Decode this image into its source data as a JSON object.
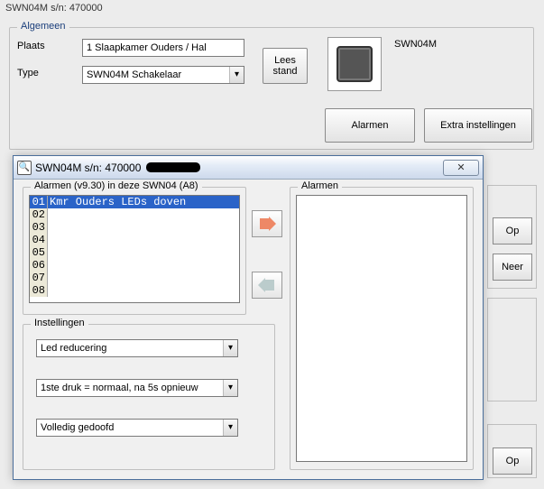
{
  "main": {
    "title": "SWN04M s/n: 470000",
    "group_algemeen": {
      "legend": "Algemeen",
      "plaats_label": "Plaats",
      "plaats_value": "1 Slaapkamer Ouders / Hal",
      "type_label": "Type",
      "type_value": "SWN04M Schakelaar",
      "lees_stand_label": "Lees\nstand",
      "device_name": "SWN04M"
    },
    "buttons": {
      "alarmen": "Alarmen",
      "extra": "Extra instellingen",
      "op": "Op",
      "neer": "Neer"
    }
  },
  "dialog": {
    "title": "SWN04M s/n: 470000",
    "list_group_legend": "Alarmen (v9.30) in deze SWN04 (A8)",
    "alarm_rows": [
      {
        "n": "01",
        "t": "Kmr Ouders LEDs doven",
        "sel": true
      },
      {
        "n": "02",
        "t": ""
      },
      {
        "n": "03",
        "t": ""
      },
      {
        "n": "04",
        "t": ""
      },
      {
        "n": "05",
        "t": ""
      },
      {
        "n": "06",
        "t": ""
      },
      {
        "n": "07",
        "t": ""
      },
      {
        "n": "08",
        "t": ""
      }
    ],
    "inst_legend": "Instellingen",
    "inst_combo1": "Led reducering",
    "inst_combo2": "1ste druk = normaal, na 5s opnieuw",
    "inst_combo3": "Volledig gedoofd",
    "right_legend": "Alarmen",
    "close_glyph": "⌦"
  }
}
